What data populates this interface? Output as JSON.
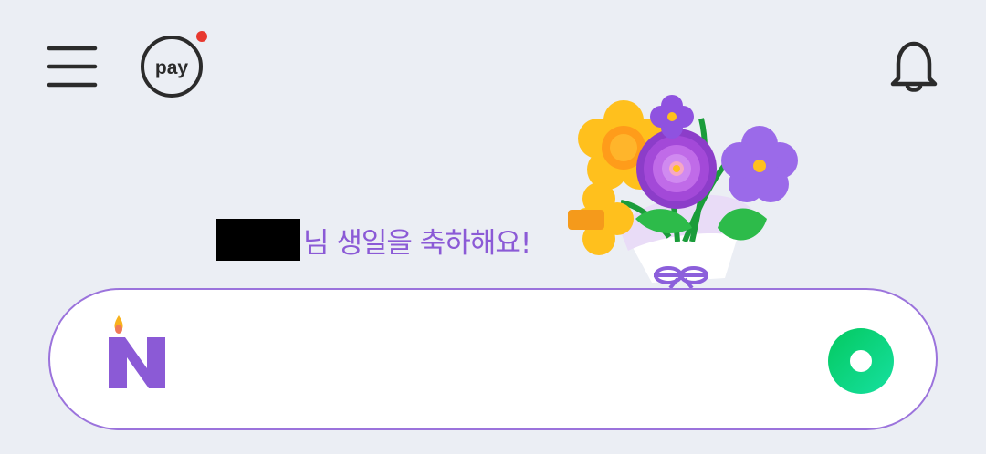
{
  "header": {
    "menu_icon": "hamburger-menu-icon",
    "pay_label": "pay",
    "pay_notification_color": "#e8382f",
    "bell_icon": "bell-icon"
  },
  "greeting": {
    "text": "님 생일을 축하해요!",
    "name_redacted": true,
    "color": "#8b5ad6"
  },
  "illustration": {
    "icon": "birthday-bouquet-icon"
  },
  "search": {
    "placeholder": "",
    "logo_letter": "N",
    "logo_color": "#8b5ad6",
    "border_color": "#9b73dc",
    "search_button_icon": "green-search-icon",
    "search_button_color": "#0ed37a"
  }
}
